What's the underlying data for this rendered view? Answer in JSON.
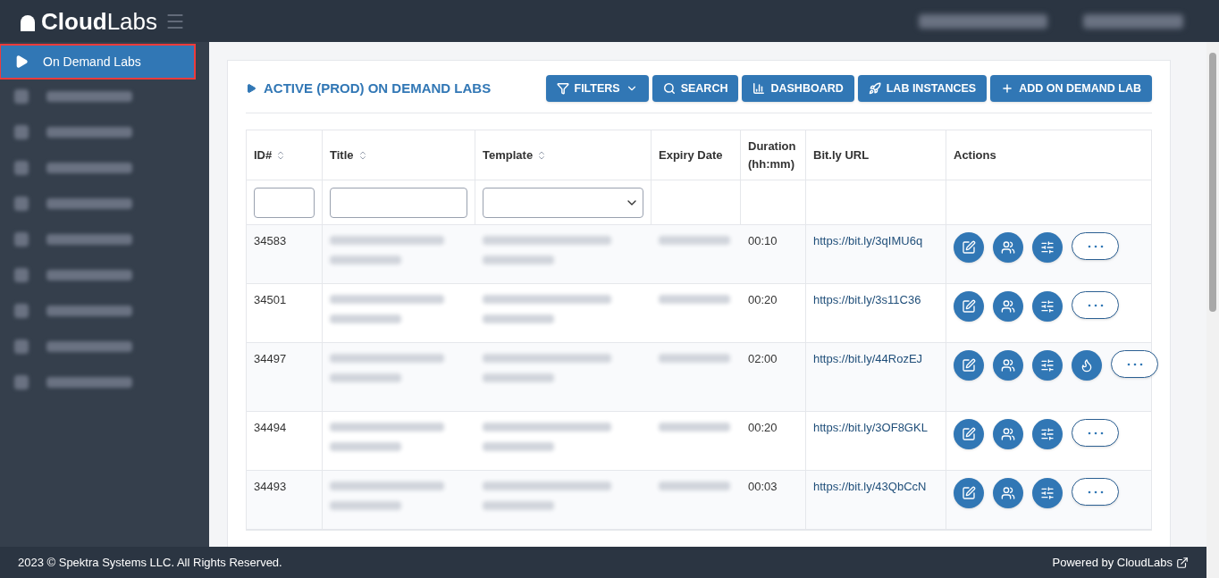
{
  "logo": {
    "bold": "Cloud",
    "light": "Labs"
  },
  "sidebar": {
    "items": [
      {
        "label": "On Demand Labs",
        "selected": true
      }
    ]
  },
  "page": {
    "title": "ACTIVE (PROD) ON DEMAND LABS",
    "buttons": [
      {
        "kind": "filter",
        "label": "FILTERS"
      },
      {
        "kind": "search",
        "label": "SEARCH"
      },
      {
        "kind": "dashboard",
        "label": "DASHBOARD"
      },
      {
        "kind": "rocket",
        "label": "LAB INSTANCES"
      },
      {
        "kind": "add",
        "label": "ADD ON DEMAND LAB"
      }
    ]
  },
  "table": {
    "columns": [
      {
        "label": "ID#",
        "sortable": true
      },
      {
        "label": "Title",
        "sortable": true
      },
      {
        "label": "Template",
        "sortable": true
      },
      {
        "label": "Expiry Date",
        "sortable": false
      },
      {
        "label": "Duration (hh:mm)",
        "sortable": false
      },
      {
        "label": "Bit.ly URL",
        "sortable": false
      },
      {
        "label": "Actions",
        "sortable": false
      }
    ],
    "filters": [
      {
        "kind": "text"
      },
      {
        "kind": "text"
      },
      {
        "kind": "select"
      },
      {
        "kind": "none"
      },
      {
        "kind": "none"
      },
      {
        "kind": "none"
      },
      {
        "kind": "none"
      }
    ],
    "rows": [
      {
        "id": "34583",
        "duration": "00:10",
        "url": "https://bit.ly/3qIMU6q",
        "actions": [
          {
            "kind": "edit"
          },
          {
            "kind": "users"
          },
          {
            "kind": "sliders"
          },
          {
            "kind": "more"
          }
        ]
      },
      {
        "id": "34501",
        "duration": "00:20",
        "url": "https://bit.ly/3s11C36",
        "actions": [
          {
            "kind": "edit"
          },
          {
            "kind": "users"
          },
          {
            "kind": "sliders"
          },
          {
            "kind": "more"
          }
        ]
      },
      {
        "id": "34497",
        "duration": "02:00",
        "url": "https://bit.ly/44RozEJ",
        "actions": [
          {
            "kind": "edit"
          },
          {
            "kind": "users"
          },
          {
            "kind": "sliders"
          },
          {
            "kind": "flame"
          },
          {
            "kind": "more"
          }
        ]
      },
      {
        "id": "34494",
        "duration": "00:20",
        "url": "https://bit.ly/3OF8GKL",
        "actions": [
          {
            "kind": "edit"
          },
          {
            "kind": "users"
          },
          {
            "kind": "sliders"
          },
          {
            "kind": "more"
          }
        ]
      },
      {
        "id": "34493",
        "duration": "00:03",
        "url": "https://bit.ly/43QbCcN",
        "actions": [
          {
            "kind": "edit"
          },
          {
            "kind": "users"
          },
          {
            "kind": "sliders"
          },
          {
            "kind": "more"
          }
        ]
      }
    ]
  },
  "footer": {
    "copyright": "2023 © Spektra Systems LLC. All Rights Reserved.",
    "powered": "Powered by CloudLabs"
  }
}
